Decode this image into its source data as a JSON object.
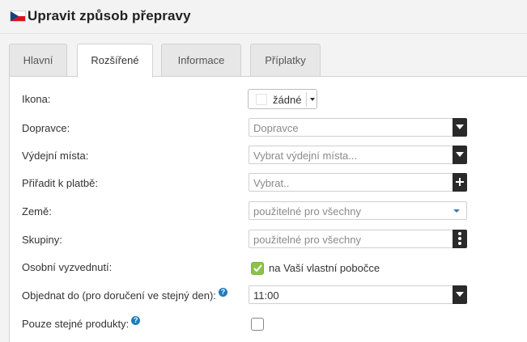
{
  "header": {
    "title": "Upravit způsob přepravy"
  },
  "tabs": [
    {
      "label": "Hlavní",
      "active": false
    },
    {
      "label": "Rozšířené",
      "active": true
    },
    {
      "label": "Informace",
      "active": false
    },
    {
      "label": "Příplatky",
      "active": false
    }
  ],
  "form": {
    "icon": {
      "label": "Ikona:",
      "value": "žádné"
    },
    "carriers": {
      "label": "Dopravce:",
      "placeholder": "Dopravce"
    },
    "pickup_points": {
      "label": "Výdejní místa:",
      "placeholder": "Vybrat výdejní místa..."
    },
    "payment": {
      "label": "Přiřadit k platbě:",
      "placeholder": "Vybrat.."
    },
    "country": {
      "label": "Země:",
      "value": "použitelné pro všechny"
    },
    "groups": {
      "label": "Skupiny:",
      "value": "použitelné pro všechny"
    },
    "personal_pickup": {
      "label": "Osobní vyzvednutí:",
      "checkbox_label": "na Vaší vlastní pobočce",
      "checked": true
    },
    "order_until": {
      "label": "Objednat do (pro doručení ve stejný den):",
      "value": "11:00"
    },
    "same_products": {
      "label": "Pouze stejné produkty:",
      "checked": false
    }
  },
  "colors": {
    "accent_green": "#8bc34a",
    "help_blue": "#1d7cc0",
    "button_dark": "#2a2a2a"
  }
}
